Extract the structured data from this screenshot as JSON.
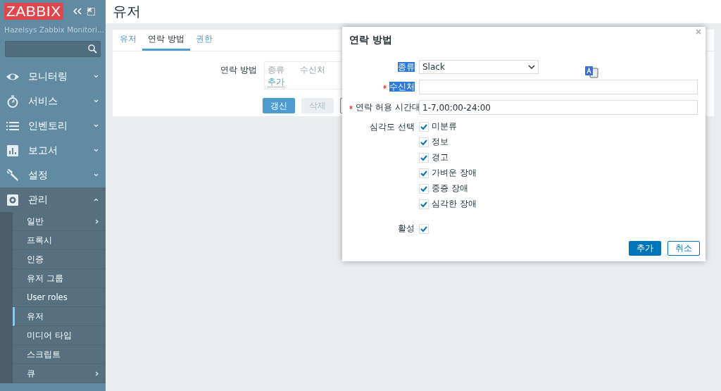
{
  "sidebar": {
    "logo": "ZABBIX",
    "server_name": "Hazelsys Zabbix Monitori...",
    "menu": [
      {
        "label": "모니터링",
        "kind": "eye",
        "expanded": false
      },
      {
        "label": "서비스",
        "kind": "stopwatch",
        "expanded": false
      },
      {
        "label": "인벤토리",
        "kind": "list",
        "expanded": false
      },
      {
        "label": "보고서",
        "kind": "chart",
        "expanded": false
      },
      {
        "label": "설정",
        "kind": "wrench",
        "expanded": false
      },
      {
        "label": "관리",
        "kind": "gear",
        "expanded": true,
        "children": [
          {
            "label": "일반",
            "submenu": true,
            "selected": false
          },
          {
            "label": "프록시",
            "submenu": false,
            "selected": false
          },
          {
            "label": "인증",
            "submenu": false,
            "selected": false
          },
          {
            "label": "유저 그룹",
            "submenu": false,
            "selected": false
          },
          {
            "label": "User roles",
            "submenu": false,
            "selected": false
          },
          {
            "label": "유저",
            "submenu": false,
            "selected": true
          },
          {
            "label": "미디어 타입",
            "submenu": false,
            "selected": false
          },
          {
            "label": "스크립트",
            "submenu": false,
            "selected": false
          },
          {
            "label": "큐",
            "submenu": true,
            "selected": false
          }
        ]
      }
    ]
  },
  "page": {
    "title": "유저",
    "tabs": [
      {
        "label": "유저",
        "selected": false
      },
      {
        "label": "연락 방법",
        "selected": true
      },
      {
        "label": "권한",
        "selected": false
      }
    ],
    "media_label": "연락 방법",
    "columns": [
      "종류",
      "수신처"
    ],
    "add_link": "추가",
    "buttons": [
      {
        "label": "갱신",
        "kind": "primary"
      },
      {
        "label": "삭제",
        "kind": "disabled"
      },
      {
        "kind": "hidden"
      }
    ]
  },
  "dialog": {
    "title": "연락 방법",
    "type": {
      "label": "종류",
      "highlighted": true,
      "value": "Slack"
    },
    "send_to": {
      "label": "수신처",
      "required": true,
      "highlighted": true
    },
    "when_active": {
      "label": "연락 허용 시간대",
      "required": true,
      "highlighted": false,
      "value": "1-7,00:00-24:00"
    },
    "severity_label": "심각도 선택",
    "severities": [
      {
        "label": "미분류",
        "checked": true
      },
      {
        "label": "정보",
        "checked": true
      },
      {
        "label": "경고",
        "checked": true
      },
      {
        "label": "가벼운 장애",
        "checked": true
      },
      {
        "label": "중증 장애",
        "checked": true
      },
      {
        "label": "심각한 장애",
        "checked": true
      }
    ],
    "enabled": {
      "label": "활성",
      "checked": true
    },
    "buttons": [
      {
        "label": "추가",
        "kind": "primary"
      },
      {
        "label": "취소",
        "kind": "secondary"
      }
    ]
  }
}
